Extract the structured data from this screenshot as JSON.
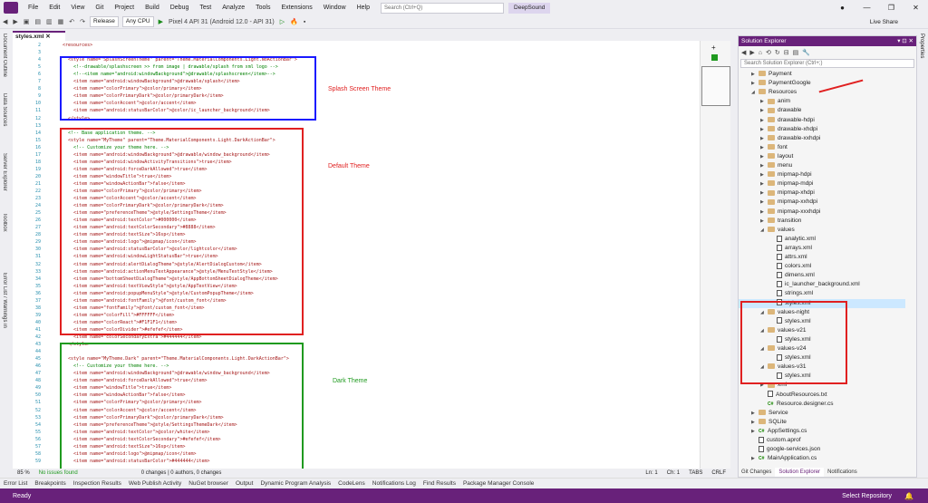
{
  "menu": [
    "File",
    "Edit",
    "View",
    "Git",
    "Project",
    "Build",
    "Debug",
    "Test",
    "Analyze",
    "Tools",
    "Extensions",
    "Window",
    "Help"
  ],
  "search_placeholder": "Search (Ctrl+Q)",
  "solution_name": "DeepSound",
  "toolbar": {
    "config": "Release",
    "platform": "Any CPU",
    "device": "Pixel 4 API 31 (Android 12.0 - API 31)",
    "live_share": "Live Share"
  },
  "left_tabs": [
    "Document Outline",
    "Data Sources",
    "Server Explorer",
    "Toolbox",
    "Error List / Warnings in Solution"
  ],
  "right_tabs": [
    "Properties"
  ],
  "editor_tab": "styles.xml",
  "line_numbers": [
    2,
    3,
    4,
    5,
    6,
    7,
    8,
    9,
    10,
    11,
    12,
    13,
    14,
    15,
    16,
    17,
    18,
    19,
    20,
    21,
    22,
    23,
    24,
    25,
    26,
    27,
    28,
    29,
    30,
    31,
    32,
    33,
    34,
    35,
    36,
    37,
    38,
    39,
    40,
    41,
    42,
    43,
    44,
    45,
    46,
    47,
    48,
    49,
    50,
    51,
    52,
    53,
    54,
    55,
    56,
    57,
    58,
    59
  ],
  "code_lines": [
    "<resources>",
    "",
    "  <style name=\"SplashScreenTheme\" parent=\"Theme.MaterialComponents.Light.NoActionBar\">",
    "    <!--drawable/splashscreen >> from image | drawable/splash from xml logo -->",
    "    <!--<item name=\"android:windowBackground\">@drawable/splashscreen</item>-->",
    "    <item name=\"android:windowBackground\">@drawable/splash</item>",
    "    <item name=\"colorPrimary\">@color/primary</item>",
    "    <item name=\"colorPrimaryDark\">@color/primaryDark</item>",
    "    <item name=\"colorAccent\">@color/accent</item>",
    "    <item name=\"android:statusBarColor\">@color/ic_launcher_background</item>",
    "  </style>",
    "",
    "  <!-- Base application theme. -->",
    "  <style name=\"MyTheme\" parent=\"Theme.MaterialComponents.Light.DarkActionBar\">",
    "    <!-- Customize your theme here. -->",
    "    <item name=\"android:windowBackground\">@drawable/window_background</item>",
    "    <item name=\"android:windowActivityTransitions\">true</item>",
    "    <item name=\"android:forceDarkAllowed\">true</item>",
    "    <item name=\"windowTitle\">true</item>",
    "    <item name=\"windowActionBar\">false</item>",
    "    <item name=\"colorPrimary\">@color/primary</item>",
    "    <item name=\"colorAccent\">@color/accent</item>",
    "    <item name=\"colorPrimaryDark\">@color/primaryDark</item>",
    "    <item name=\"preferenceTheme\">@style/SettingsTheme</item>",
    "    <item name=\"android:textColor\">#000000</item>",
    "    <item name=\"android:textColorSecondary\">#8888</item>",
    "    <item name=\"android:textSize\">16sp</item>",
    "    <item name=\"android:logo\">@mipmap/icon</item>",
    "    <item name=\"android:statusBarColor\">@color/lightcolor</item>",
    "    <item name=\"android:windowLightStatusBar\">true</item>",
    "    <item name=\"android:alertDialogTheme\">@style/AlertDialogCustom</item>",
    "    <item name=\"android:actionMenuTextAppearance\">@style/MenuTextStyle</item>",
    "    <item name=\"bottomSheetDialogTheme\">@style/AppBottomSheetDialogTheme</item>",
    "    <item name=\"android:textViewStyle\">@style/AppTextView</item>",
    "    <item name=\"android:popupMenuStyle\">@style/CustomPopupTheme</item>",
    "    <item name=\"android:fontFamily\">@font/custom_font</item>",
    "    <item name=\"fontFamily\">@font/custom_font</item>",
    "    <item name=\"colorFill\">#FFFFFF</item>",
    "    <item name=\"colorReact\">#F1F1F1</item>",
    "    <item name=\"colorDivider\">#efefef</item>",
    "    <item name=\"colorSecondaryExtra\">#444444</item>",
    "  </style>",
    "",
    "  <style name=\"MyTheme.Dark\" parent=\"Theme.MaterialComponents.Light.DarkActionBar\">",
    "    <!-- Customize your theme here. -->",
    "    <item name=\"android:windowBackground\">@drawable/window_background</item>",
    "    <item name=\"android:forceDarkAllowed\">true</item>",
    "    <item name=\"windowTitle\">true</item>",
    "    <item name=\"windowActionBar\">false</item>",
    "    <item name=\"colorPrimary\">@color/primary</item>",
    "    <item name=\"colorAccent\">@color/accent</item>",
    "    <item name=\"colorPrimaryDark\">@color/primaryDark</item>",
    "    <item name=\"preferenceTheme\">@style/SettingsThemeDark</item>",
    "    <item name=\"android:textColor\">@color/white</item>",
    "    <item name=\"android:textColorSecondary\">#efefef</item>",
    "    <item name=\"android:textSize\">16sp</item>",
    "    <item name=\"android:logo\">@mipmap/icon</item>",
    "    <item name=\"android:statusBarColor\">#444444</item>",
    "    <item name=\"android:windowLightStatusBar\">false</item>",
    "    <item name=\"android:alertDialogTheme\">@style/AlertDialogCustomDark</item>",
    "    <item name=\"android:actionMenuTextAppearance\">@style/MenuTextStyle</item>"
  ],
  "annotations": {
    "splash": "Splash Screen Theme",
    "default": "Default Theme",
    "dark": "Dark Theme"
  },
  "annotation_colors": {
    "splash": "#1a1aff",
    "default": "#e02020",
    "dark": "#1f9a1f"
  },
  "editor_status": {
    "zoom": "85 %",
    "issues": "No issues found",
    "changes": "0 changes | 0 authors, 0 changes",
    "line": "Ln: 1",
    "col": "Ch: 1",
    "tabs": "TABS",
    "eol": "CRLF"
  },
  "solution_explorer": {
    "title": "Solution Explorer",
    "search_placeholder": "Search Solution Explorer (Ctrl+;)",
    "items": [
      {
        "label": "Payment",
        "type": "folder",
        "depth": 1,
        "arrow": "▶"
      },
      {
        "label": "PaymentGoogle",
        "type": "folder",
        "depth": 1,
        "arrow": "▶"
      },
      {
        "label": "Resources",
        "type": "folder",
        "depth": 1,
        "arrow": "◢"
      },
      {
        "label": "anim",
        "type": "folder",
        "depth": 2,
        "arrow": "▶"
      },
      {
        "label": "drawable",
        "type": "folder",
        "depth": 2,
        "arrow": "▶"
      },
      {
        "label": "drawable-hdpi",
        "type": "folder",
        "depth": 2,
        "arrow": "▶"
      },
      {
        "label": "drawable-xhdpi",
        "type": "folder",
        "depth": 2,
        "arrow": "▶"
      },
      {
        "label": "drawable-xxhdpi",
        "type": "folder",
        "depth": 2,
        "arrow": "▶"
      },
      {
        "label": "font",
        "type": "folder",
        "depth": 2,
        "arrow": "▶"
      },
      {
        "label": "layout",
        "type": "folder",
        "depth": 2,
        "arrow": "▶"
      },
      {
        "label": "menu",
        "type": "folder",
        "depth": 2,
        "arrow": "▶"
      },
      {
        "label": "mipmap-hdpi",
        "type": "folder",
        "depth": 2,
        "arrow": "▶"
      },
      {
        "label": "mipmap-mdpi",
        "type": "folder",
        "depth": 2,
        "arrow": "▶"
      },
      {
        "label": "mipmap-xhdpi",
        "type": "folder",
        "depth": 2,
        "arrow": "▶"
      },
      {
        "label": "mipmap-xxhdpi",
        "type": "folder",
        "depth": 2,
        "arrow": "▶"
      },
      {
        "label": "mipmap-xxxhdpi",
        "type": "folder",
        "depth": 2,
        "arrow": "▶"
      },
      {
        "label": "transition",
        "type": "folder",
        "depth": 2,
        "arrow": "▶"
      },
      {
        "label": "values",
        "type": "folder",
        "depth": 2,
        "arrow": "◢"
      },
      {
        "label": "analytic.xml",
        "type": "file",
        "depth": 3,
        "arrow": ""
      },
      {
        "label": "arrays.xml",
        "type": "file",
        "depth": 3,
        "arrow": ""
      },
      {
        "label": "attrs.xml",
        "type": "file",
        "depth": 3,
        "arrow": ""
      },
      {
        "label": "colors.xml",
        "type": "file",
        "depth": 3,
        "arrow": ""
      },
      {
        "label": "dimens.xml",
        "type": "file",
        "depth": 3,
        "arrow": ""
      },
      {
        "label": "ic_launcher_background.xml",
        "type": "file",
        "depth": 3,
        "arrow": ""
      },
      {
        "label": "strings.xml",
        "type": "file",
        "depth": 3,
        "arrow": ""
      },
      {
        "label": "styles.xml",
        "type": "file",
        "depth": 3,
        "arrow": "",
        "selected": true
      },
      {
        "label": "values-night",
        "type": "folder",
        "depth": 2,
        "arrow": "◢"
      },
      {
        "label": "styles.xml",
        "type": "file",
        "depth": 3,
        "arrow": ""
      },
      {
        "label": "values-v21",
        "type": "folder",
        "depth": 2,
        "arrow": "◢"
      },
      {
        "label": "styles.xml",
        "type": "file",
        "depth": 3,
        "arrow": ""
      },
      {
        "label": "values-v24",
        "type": "folder",
        "depth": 2,
        "arrow": "◢"
      },
      {
        "label": "styles.xml",
        "type": "file",
        "depth": 3,
        "arrow": ""
      },
      {
        "label": "values-v31",
        "type": "folder",
        "depth": 2,
        "arrow": "◢"
      },
      {
        "label": "styles.xml",
        "type": "file",
        "depth": 3,
        "arrow": ""
      },
      {
        "label": "xml",
        "type": "folder",
        "depth": 2,
        "arrow": "▶"
      },
      {
        "label": "AboutResources.txt",
        "type": "file",
        "depth": 2,
        "arrow": ""
      },
      {
        "label": "Resource.designer.cs",
        "type": "cs",
        "depth": 2,
        "arrow": ""
      },
      {
        "label": "Service",
        "type": "folder",
        "depth": 1,
        "arrow": "▶"
      },
      {
        "label": "SQLite",
        "type": "folder",
        "depth": 1,
        "arrow": "▶"
      },
      {
        "label": "AppSettings.cs",
        "type": "cs",
        "depth": 1,
        "arrow": "▶"
      },
      {
        "label": "custom.aprof",
        "type": "file",
        "depth": 1,
        "arrow": ""
      },
      {
        "label": "google-services.json",
        "type": "file",
        "depth": 1,
        "arrow": ""
      },
      {
        "label": "MainApplication.cs",
        "type": "cs",
        "depth": 1,
        "arrow": "▶"
      }
    ],
    "tabs": [
      "Git Changes",
      "Solution Explorer",
      "Notifications"
    ]
  },
  "bottom_tabs": [
    "Error List",
    "Breakpoints",
    "Inspection Results",
    "Web Publish Activity",
    "NuGet browser",
    "Output",
    "Dynamic Program Analysis",
    "CodeLens",
    "Notifications Log",
    "Find Results",
    "Package Manager Console"
  ],
  "status": {
    "left": "Ready",
    "right": "Select Repository"
  }
}
